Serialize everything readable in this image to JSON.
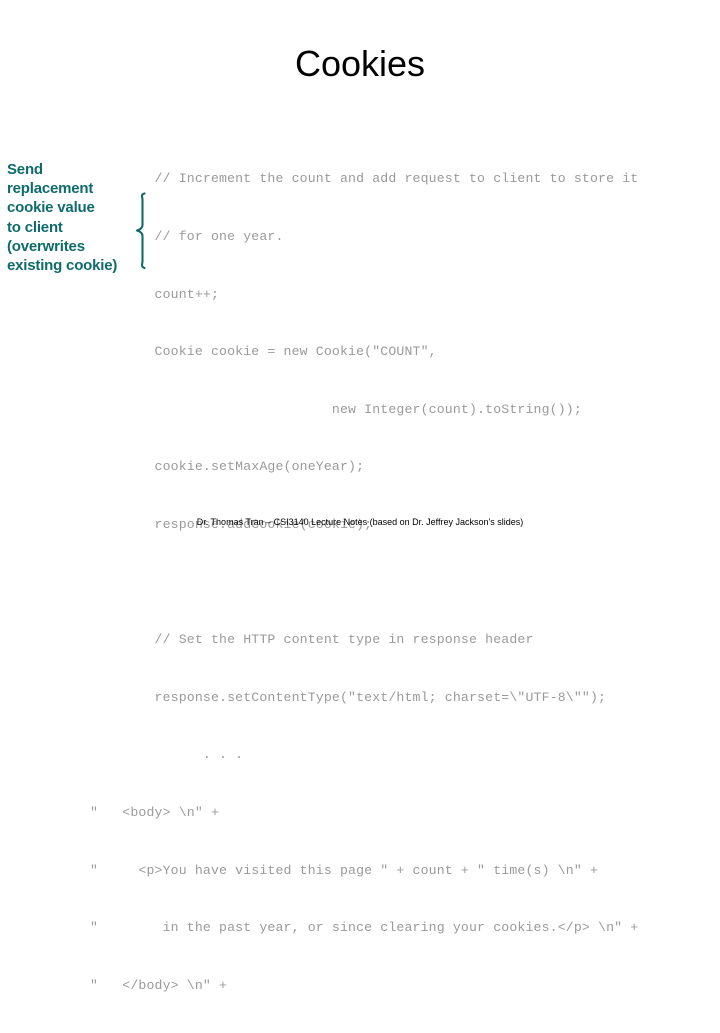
{
  "slide": {
    "title": "Cookies",
    "annotation": {
      "lines": [
        "Send",
        "replacement",
        "cookie value",
        "to client",
        "(overwrites",
        "existing cookie)"
      ],
      "brace_glyph": "left-curly-brace",
      "color": "#0f6b6b"
    },
    "code": {
      "color": "#9a9a9a",
      "lines": [
        "        // Increment the count and add request to client to store it",
        "        // for one year.",
        "        count++;",
        "        Cookie cookie = new Cookie(\"COUNT\",",
        "                              new Integer(count).toString());",
        "        cookie.setMaxAge(oneYear);",
        "        response.addCookie(cookie);",
        "",
        "        // Set the HTTP content type in response header",
        "        response.setContentType(\"text/html; charset=\\\"UTF-8\\\"\");",
        "              . . .",
        "\"   <body> \\n\" +",
        "\"     <p>You have visited this page \" + count + \" time(s) \\n\" +",
        "\"        in the past year, or since clearing your cookies.</p> \\n\" +",
        "\"   </body> \\n\" +"
      ]
    },
    "footer": "Dr. Thomas Tran – CSI3140 Lecture Notes (based on Dr. Jeffrey Jackson's slides)"
  }
}
